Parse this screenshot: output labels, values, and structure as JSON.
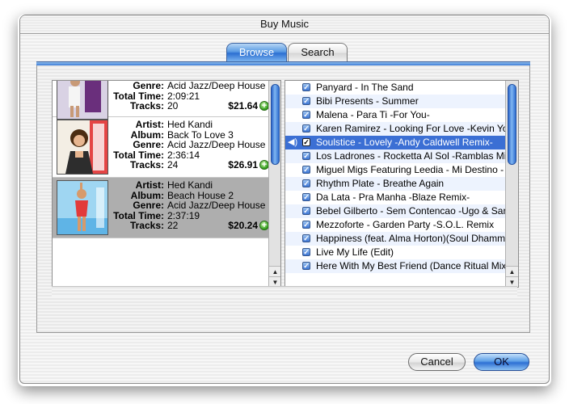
{
  "window": {
    "title": "Buy Music"
  },
  "tabs": [
    {
      "label": "Browse",
      "active": true
    },
    {
      "label": "Search",
      "active": false
    }
  ],
  "albums": [
    {
      "genre": "Acid Jazz/Deep House",
      "total_time": "2:09:21",
      "tracks": "20",
      "price": "$21.64",
      "selected": false
    },
    {
      "artist": "Hed Kandi",
      "album": "Back To Love 3",
      "genre": "Acid Jazz/Deep House",
      "total_time": "2:36:14",
      "tracks": "24",
      "price": "$26.91",
      "selected": false
    },
    {
      "artist": "Hed Kandi",
      "album": "Beach House 2",
      "genre": "Acid Jazz/Deep House",
      "total_time": "2:37:19",
      "tracks": "22",
      "price": "$20.24",
      "selected": true
    }
  ],
  "labels": {
    "artist": "Artist:",
    "album": "Album:",
    "genre": "Genre:",
    "total_time": "Total Time:",
    "tracks": "Tracks:"
  },
  "tracks": [
    {
      "name": "Panyard - In The Sand",
      "checked": true,
      "playing": false
    },
    {
      "name": "Bibi Presents - Summer",
      "checked": true,
      "playing": false
    },
    {
      "name": "Malena - Para Ti -For You-",
      "checked": true,
      "playing": false
    },
    {
      "name": "Karen Ramirez - Looking For Love -Kevin Yo",
      "checked": true,
      "playing": false
    },
    {
      "name": "Soulstice - Lovely -Andy Caldwell Remix-",
      "checked": true,
      "playing": true
    },
    {
      "name": "Los Ladrones - Rocketta Al Sol -Ramblas Mi",
      "checked": true,
      "playing": false
    },
    {
      "name": "Miguel Migs Featuring Leedia - Mi Destino -",
      "checked": true,
      "playing": false
    },
    {
      "name": "Rhythm Plate - Breathe Again",
      "checked": true,
      "playing": false
    },
    {
      "name": "Da Lata - Pra Manha -Blaze Remix-",
      "checked": true,
      "playing": false
    },
    {
      "name": "Bebel Gilberto - Sem Contencao -Ugo & Sar",
      "checked": true,
      "playing": false
    },
    {
      "name": "Mezzoforte - Garden Party -S.O.L. Remix",
      "checked": true,
      "playing": false
    },
    {
      "name": "Happiness (feat. Alma Horton)(Soul Dhamm",
      "checked": true,
      "playing": false
    },
    {
      "name": "Live My Life (Edit)",
      "checked": true,
      "playing": false
    },
    {
      "name": "Here With My Best Friend (Dance Ritual Mix)",
      "checked": true,
      "playing": false
    }
  ],
  "buttons": {
    "cancel": "Cancel",
    "ok": "OK"
  },
  "colors": {
    "accent": "#3b6fd4",
    "plus_button": "#2f9b1a"
  }
}
